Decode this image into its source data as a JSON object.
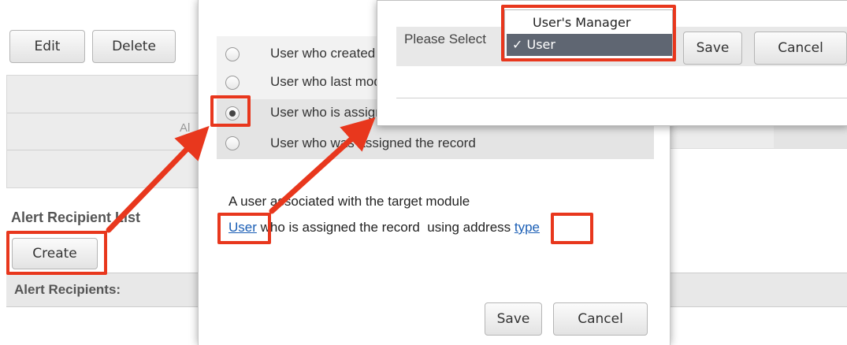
{
  "background": {
    "edit_label": "Edit",
    "delete_label": "Delete",
    "table_cell_text": "Al",
    "alert_recipient_list_label": "Alert Recipient List",
    "create_label": "Create",
    "alert_recipients_label": "Alert Recipients:"
  },
  "dialog": {
    "options": [
      {
        "label": "User who created the record",
        "selected": false
      },
      {
        "label": "User who last modified the record",
        "selected": false
      },
      {
        "label": "User who is assigned the record",
        "selected": true
      },
      {
        "label": "User who was assigned the record",
        "selected": false
      }
    ],
    "description": "A user associated with the target module",
    "link_user": "User",
    "middle_text": " who is assigned the record  using address ",
    "link_type": "type",
    "save_label": "Save",
    "cancel_label": "Cancel"
  },
  "popup": {
    "please_select_label": "Please Select",
    "dropdown_options": [
      {
        "label": "User's Manager",
        "selected": false
      },
      {
        "label": "✓ User",
        "selected": true
      }
    ],
    "save_label": "Save",
    "cancel_label": "Cancel"
  },
  "colors": {
    "annotation_red": "#e8371d",
    "link_blue": "#1a5eb5",
    "dropdown_highlight": "#5f6672"
  }
}
